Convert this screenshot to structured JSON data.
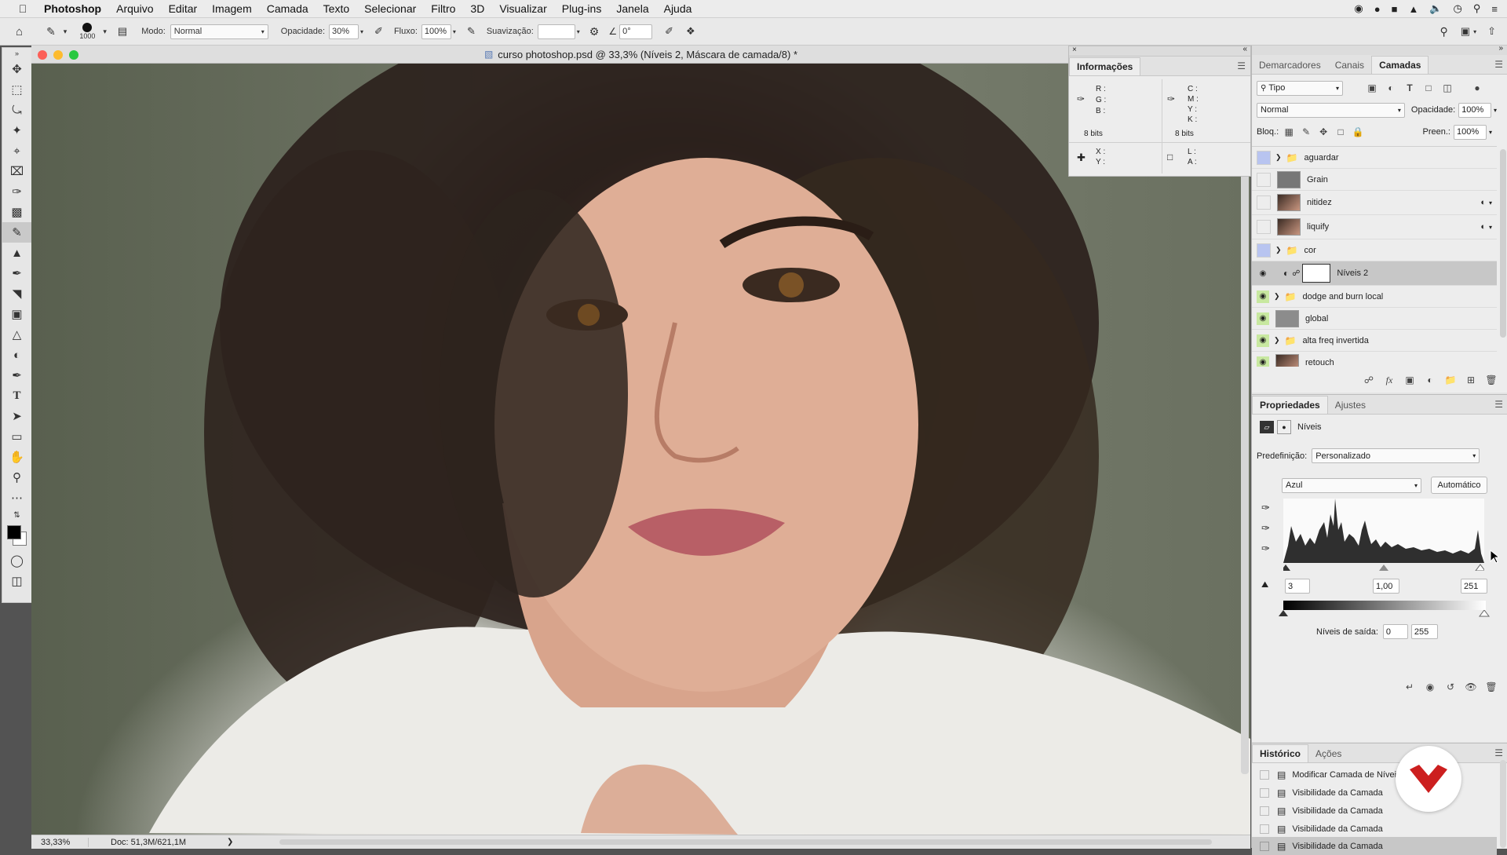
{
  "menubar": {
    "app": "Photoshop",
    "items": [
      "Arquivo",
      "Editar",
      "Imagem",
      "Camada",
      "Texto",
      "Selecionar",
      "Filtro",
      "3D",
      "Visualizar",
      "Plug-ins",
      "Janela",
      "Ajuda"
    ]
  },
  "options": {
    "brush_size": "1000",
    "mode_label": "Modo:",
    "mode_value": "Normal",
    "opacity_label": "Opacidade:",
    "opacity_value": "30%",
    "flow_label": "Fluxo:",
    "flow_value": "100%",
    "smoothing_label": "Suavização:",
    "smoothing_value": "",
    "angle_value": "0°"
  },
  "document": {
    "title": "curso photoshop.psd @ 33,3% (Níveis 2, Máscara de camada/8) *",
    "zoom": "33,33%",
    "doc_size": "Doc: 51,3M/621,1M"
  },
  "info_panel": {
    "tab": "Informações",
    "rgb_labels": [
      "R :",
      "G :",
      "B :"
    ],
    "cmyk_labels": [
      "C :",
      "M :",
      "Y :",
      "K :"
    ],
    "bits_left": "8 bits",
    "bits_right": "8 bits",
    "xy_labels": [
      "X :",
      "Y :"
    ],
    "la_labels": [
      "L :",
      "A :"
    ]
  },
  "layers_panel": {
    "tabs": [
      "Demarcadores",
      "Canais",
      "Camadas"
    ],
    "active_tab": "Camadas",
    "filter": "Tipo",
    "blend_mode": "Normal",
    "opacity_label": "Opacidade:",
    "opacity_value": "100%",
    "lock_label": "Bloq.:",
    "fill_label": "Preen.:",
    "fill_value": "100%",
    "layers": [
      {
        "name": "aguardar",
        "type": "group",
        "visible": false,
        "color": "#b8c4f0"
      },
      {
        "name": "Grain",
        "type": "layer",
        "visible": false,
        "color": ""
      },
      {
        "name": "nitidez",
        "type": "photo",
        "visible": false,
        "color": ""
      },
      {
        "name": "liquify",
        "type": "photo",
        "visible": false,
        "color": ""
      },
      {
        "name": "cor",
        "type": "group",
        "visible": false,
        "color": "#b8c4f0"
      },
      {
        "name": "Níveis 2",
        "type": "adjustment",
        "visible": true,
        "color": "",
        "selected": true
      },
      {
        "name": "dodge and burn local",
        "type": "group",
        "visible": true,
        "color": "#c8e8a0"
      },
      {
        "name": "global",
        "type": "layer",
        "visible": true,
        "color": "#c8e8a0"
      },
      {
        "name": "alta freq invertida",
        "type": "group",
        "visible": true,
        "color": "#c8e8a0"
      },
      {
        "name": "retouch",
        "type": "photo",
        "visible": true,
        "color": "#c8e8a0"
      }
    ]
  },
  "properties_panel": {
    "tabs": [
      "Propriedades",
      "Ajustes"
    ],
    "active_tab": "Propriedades",
    "adjustment_name": "Níveis",
    "preset_label": "Predefinição:",
    "preset_value": "Personalizado",
    "channel_value": "Azul",
    "auto_button": "Automático",
    "input_black": "3",
    "input_gamma": "1,00",
    "input_white": "251",
    "output_label": "Níveis de saída:",
    "output_black": "0",
    "output_white": "255"
  },
  "history_panel": {
    "tabs": [
      "Histórico",
      "Ações"
    ],
    "active_tab": "Histórico",
    "items": [
      "Modificar Camada de Níveis",
      "Visibilidade da Camada",
      "Visibilidade da Camada",
      "Visibilidade da Camada",
      "Visibilidade da Camada"
    ]
  },
  "colors": {
    "accent_logo": "#cc1f1f",
    "selected_layer": "#c7c7c7"
  }
}
